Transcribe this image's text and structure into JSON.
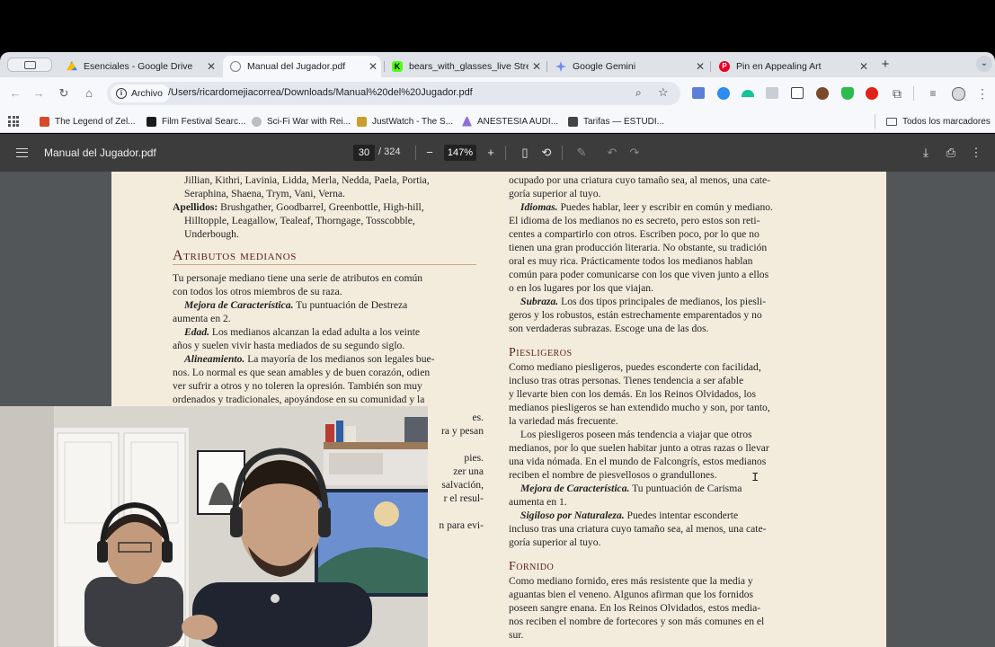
{
  "browser": {
    "tabs": [
      {
        "title": "Esenciales - Google Drive",
        "active": false,
        "favicon_color": "#34a853"
      },
      {
        "title": "Manual del Jugador.pdf",
        "active": true,
        "favicon_color": "#7b7f85"
      },
      {
        "title": "bears_with_glasses_live Stre",
        "active": false,
        "favicon_color": "#53fc18"
      },
      {
        "title": "Google Gemini",
        "active": false,
        "favicon_color": "#6f8df0"
      },
      {
        "title": "Pin en Appealing Art",
        "active": false,
        "favicon_color": "#e60023"
      }
    ],
    "address": {
      "chip_label": "Archivo",
      "url": "/Users/ricardomejiacorrea/Downloads/Manual%20del%20Jugador.pdf"
    },
    "bookmarks": [
      {
        "label": "The Legend of Zel...",
        "color": "#d44a2a"
      },
      {
        "label": "Film Festival Searc...",
        "color": "#1b1b1b"
      },
      {
        "label": "Sci-Fi War with Rei...",
        "color": "#bdbdbd"
      },
      {
        "label": "JustWatch - The S...",
        "color": "#c6a02a"
      },
      {
        "label": "ANESTESIA AUDI...",
        "color": "#8f6ed9"
      },
      {
        "label": "Tarifas — ESTUDI...",
        "color": "#444444"
      }
    ],
    "all_bookmarks_label": "Todos los marcadores"
  },
  "pdf": {
    "title": "Manual del Jugador.pdf",
    "page_current": "30",
    "page_total": "/ 324",
    "zoom": "147%"
  },
  "left_column": {
    "names_lines": [
      "Jillian, Kithri, Lavinia, Lidda, Merla, Nedda, Paela, Portia,",
      "Seraphina, Shaena, Trym, Vani, Verna."
    ],
    "surnames_label": "Apellidos:",
    "surnames_lines": [
      " Brushgather, Goodbarrel, Greenbottle, High-hill,",
      "Hilltopple, Leagallow, Tealeaf, Thorngage, Tosscobble,",
      "Underbough."
    ],
    "heading": "Atributos medianos",
    "intro_lines": [
      "Tu personaje mediano tiene una serie de atributos en común",
      "con todos los otros miembros de su raza."
    ],
    "ability_label": "Mejora de Característica.",
    "ability_lines": [
      " Tu puntuación de Destreza",
      "aumenta en 2."
    ],
    "age_label": "Edad.",
    "age_lines": [
      " Los medianos alcanzan la edad adulta a los veinte",
      "años y suelen vivir hasta mediados de su segundo siglo."
    ],
    "alignment_label": "Alineamiento.",
    "alignment_lines": [
      " La mayoría de los medianos son legales bue-",
      "nos. Lo normal es que sean amables y de buen corazón, odien",
      "ver sufrir a otros y no toleren la opresión. También son muy",
      "ordenados y tradicionales, apoyándose en su comunidad y la"
    ],
    "partial_lines": [
      "es.",
      "ra y pesan",
      "",
      "pies.",
      "zer una",
      "salvación,",
      "r el resul-",
      "",
      "n para evi-"
    ]
  },
  "right_column": {
    "top_lines": [
      "ocupado por una criatura cuyo tamaño sea, al menos, una cate-",
      "goría superior al tuyo."
    ],
    "languages_label": "Idiomas.",
    "languages_lines": [
      " Puedes hablar, leer y escribir en común y mediano.",
      "El idioma de los medianos no es secreto, pero estos son reti-",
      "centes a compartirlo con otros. Escriben poco, por lo que no",
      "tienen una gran producción literaria. No obstante, su tradición",
      "oral es muy rica. Prácticamente todos los medianos hablan",
      "común para poder comunicarse con los que viven junto a ellos",
      "o en los lugares por los que viajan."
    ],
    "subrace_label": "Subraza.",
    "subrace_lines": [
      " Los dos tipos principales de medianos, los piesli-",
      "geros y los robustos, están estrechamente emparentados y no",
      "son verdaderas subrazas. Escoge una de las dos."
    ],
    "lightfoot_heading": "Piesligeros",
    "lightfoot_lines": [
      "Como mediano piesligeros, puedes esconderte con facilidad,",
      "incluso tras otras personas. Tienes tendencia a ser afable",
      "y llevarte bien con los demás. En los Reinos Olvidados, los",
      "medianos piesligeros se han extendido mucho y son, por tanto,",
      "la variedad más frecuente."
    ],
    "lightfoot_para2": [
      "Los piesligeros poseen más tendencia a viajar que otros",
      "medianos, por lo que suelen habitar junto a otras razas o llevar",
      "una vida nómada. En el mundo de Falcongrís, estos medianos",
      "reciben el nombre de piesvellosos o grandullones."
    ],
    "lf_ability_label": "Mejora de Característica.",
    "lf_ability_lines": [
      " Tu puntuación de Carisma",
      "aumenta en 1."
    ],
    "stealthy_label": "Sigiloso por Naturaleza.",
    "stealthy_lines": [
      " Puedes intentar esconderte",
      "incluso tras una criatura cuyo tamaño sea, al menos, una cate-",
      "goría superior al tuyo."
    ],
    "stout_heading": "Fornido",
    "stout_lines": [
      "Como mediano fornido, eres más resistente que la media y",
      "aguantas bien el veneno. Algunos afirman que los fornidos",
      "poseen sangre enana. En los Reinos Olvidados, estos media-",
      "nos reciben el nombre de fortecores y son más comunes en el",
      "sur."
    ]
  }
}
